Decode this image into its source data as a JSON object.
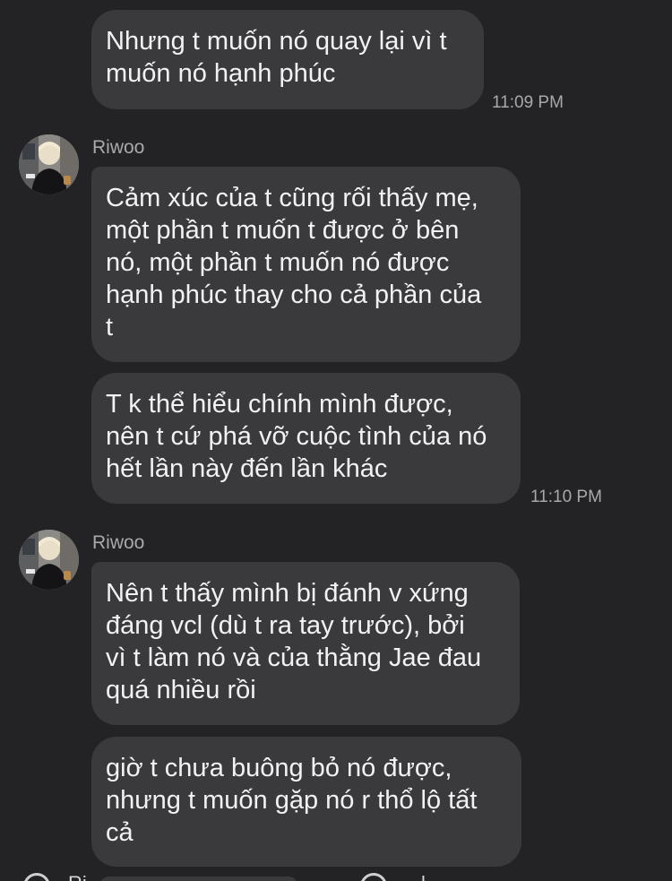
{
  "messages": [
    {
      "text": "Nhưng t muốn nó quay lại vì t\nmuốn nó hạnh phúc",
      "time": "11:09 PM"
    },
    {
      "sender": "Riwoo",
      "text": "Cảm xúc của t cũng rối thấy mẹ,\nmột phần t muốn t được ở bên\nnó, một phần t muốn nó được\nhạnh phúc thay cho cả phần của\nt"
    },
    {
      "text": "T k thể hiểu chính mình được,\nnên t cứ phá vỡ cuộc tình của nó\nhết lần này đến lần khác",
      "time": "11:10 PM"
    },
    {
      "sender": "Riwoo",
      "text": "Nên t thấy mình bị đánh v xứng\nđáng vcl (dù t ra tay trước), bởi\nvì t làm nó và của thằng Jae đau\nquá nhiều rồi"
    },
    {
      "text": "giờ t chưa buông bỏ nó được,\nnhưng t muốn gặp nó r thổ lộ tất\ncả"
    }
  ],
  "footer_partial": {
    "left_name": "Ri",
    "right_name": "l"
  },
  "colors": {
    "background": "#232326",
    "bubble": "#3a3a3d",
    "text": "#f2f2f4",
    "meta": "#a9a9ad"
  }
}
